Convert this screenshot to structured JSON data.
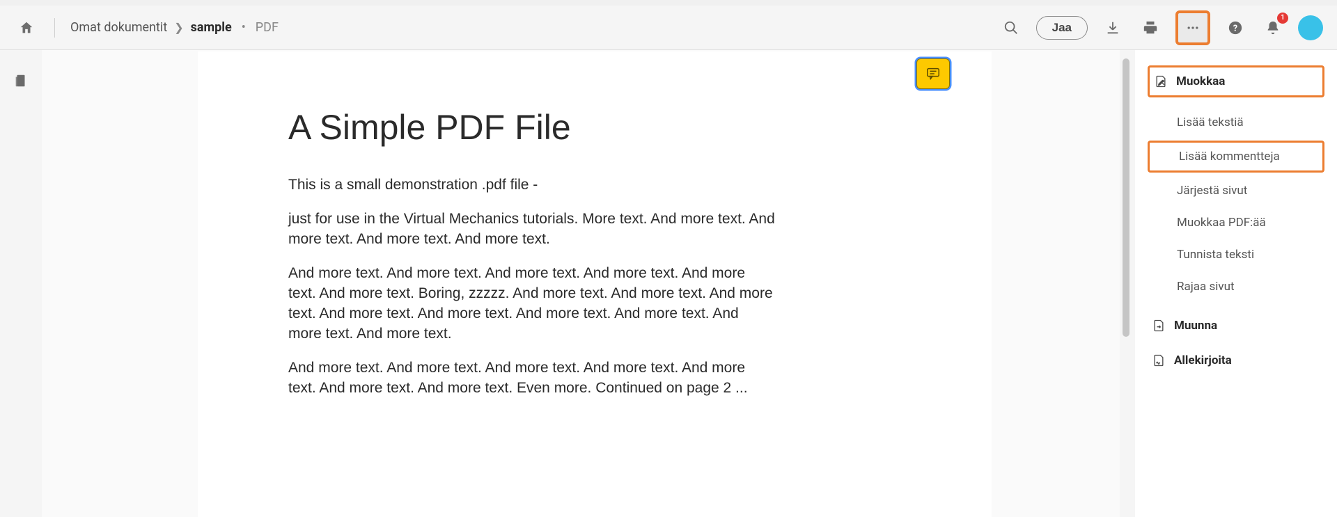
{
  "header": {
    "breadcrumb_root": "Omat dokumentit",
    "filename": "sample",
    "extension": "PDF",
    "share_label": "Jaa",
    "notification_count": "1"
  },
  "document": {
    "title": "A Simple PDF File",
    "p1": "This is a small demonstration .pdf file -",
    "p2": "just for use in the Virtual Mechanics tutorials. More text. And more text. And more text. And more text. And more text.",
    "p3": "And more text. And more text. And more text. And more text. And more text. And more text. Boring, zzzzz. And more text. And more text. And more text. And more text. And more text. And more text. And more text. And more text. And more text.",
    "p4": "And more text. And more text. And more text. And more text. And more text. And more text. And more text. Even more. Continued on page 2 ..."
  },
  "panel": {
    "edit_header": "Muokkaa",
    "add_text": "Lisää tekstiä",
    "add_comments": "Lisää kommentteja",
    "organize_pages": "Järjestä sivut",
    "edit_pdf": "Muokkaa PDF:ää",
    "recognize_text": "Tunnista teksti",
    "crop_pages": "Rajaa sivut",
    "convert_header": "Muunna",
    "sign_header": "Allekirjoita"
  }
}
